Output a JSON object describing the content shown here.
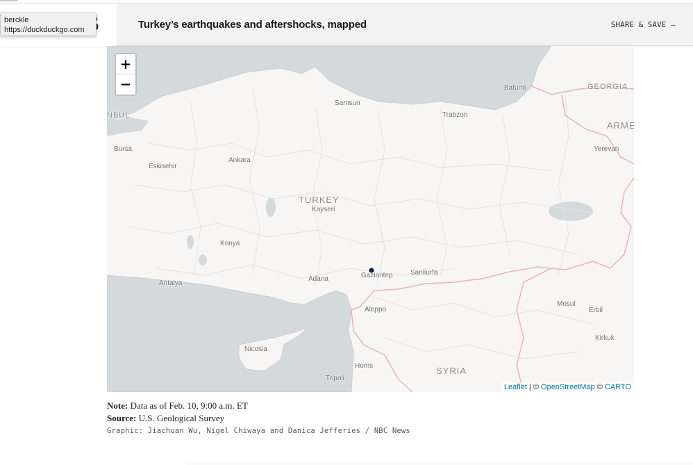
{
  "header": {
    "logo_glyph": "S",
    "title": "Turkey’s earthquakes and aftershocks, mapped",
    "share_label": "SHARE & SAVE —"
  },
  "tooltip": {
    "name": "berckle",
    "url": "https://duckduckgo.com"
  },
  "map": {
    "zoom_in": "+",
    "zoom_out": "−",
    "attribution": {
      "leaflet": "Leaflet",
      "sep": " | © ",
      "osm": "OpenStreetMap",
      "sep2": " © ",
      "carto": "CARTO"
    },
    "countries": [
      "TURKEY",
      "SYRIA",
      "GEORGIA",
      "ARME"
    ],
    "cities": [
      "Samsun",
      "Batumi",
      "Trabzon",
      "NBUL",
      "Bursa",
      "Eskisehir",
      "Ankara",
      "Kayseri",
      "Yerevan",
      "Konya",
      "Antalya",
      "Adana",
      "Gaziantep",
      "Sanliurfa",
      "Aleppo",
      "Mosul",
      "Erbil",
      "Kirkuk",
      "Nicosia",
      "Homs",
      "Tripoli"
    ],
    "colors": {
      "water": "#d4dadc",
      "land": "#f7f6f5",
      "border": "#e8b4b8",
      "province": "#e6e2e0",
      "quake": "#0d1b3e"
    }
  },
  "footer": {
    "note_label": "Note:",
    "note_text": " Data as of Feb. 10, 9:00 a.m. ET",
    "source_label": "Source:",
    "source_text": " U.S. Geological Survey",
    "credit": "Graphic: Jiachuan Wu, Nigel Chiwaya and Danica Jefferies / NBC News"
  }
}
